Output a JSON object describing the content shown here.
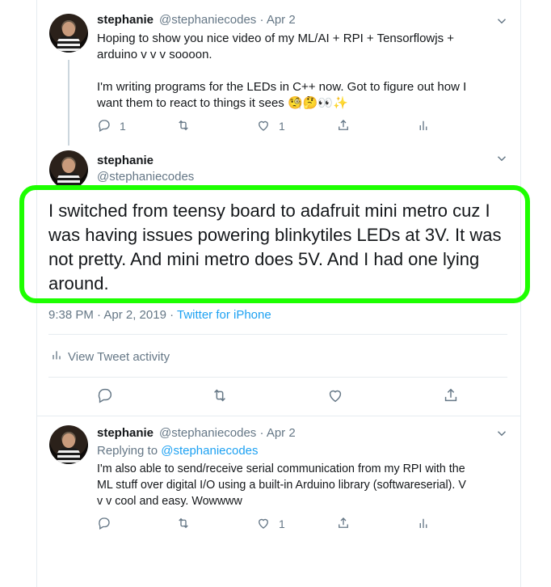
{
  "tweet1": {
    "name": "stephanie",
    "handle": "@stephaniecodes",
    "date": "· Apr 2",
    "text": "Hoping to show you nice video of my ML/AI + RPI + Tensorflowjs +\narduino v v v soooon.\n\nI'm writing programs for the LEDs in C++ now. Got to figure out how I\nwant them to react to things it sees 🧐🤔👀✨",
    "replies": "1",
    "likes": "1"
  },
  "focus": {
    "name": "stephanie",
    "handle": "@stephaniecodes",
    "text": "I switched from teensy board to adafruit mini metro cuz I was having issues powering blinkytiles LEDs at 3V. It was not pretty. And mini metro does 5V. And I had one lying around.",
    "timestamp": "9:38 PM · Apr 2, 2019 · ",
    "source": "Twitter for iPhone",
    "activity": "View Tweet activity"
  },
  "tweet3": {
    "name": "stephanie",
    "handle": "@stephaniecodes",
    "date": "· Apr 2",
    "replying_prefix": "Replying to ",
    "replying_to": "@stephaniecodes",
    "text": "I'm also able to send/receive serial communication from my RPI with the\nML stuff over digital I/O using a built-in Arduino library (softwareserial). V\nv v cool and easy. Wowwww",
    "likes": "1"
  },
  "colors": {
    "highlight": "#1dff00",
    "link": "#1da1f2",
    "muted": "#657786"
  },
  "icons": [
    "reply-icon",
    "retweet-icon",
    "like-icon",
    "share-icon",
    "analytics-icon",
    "chevron-down-icon"
  ]
}
